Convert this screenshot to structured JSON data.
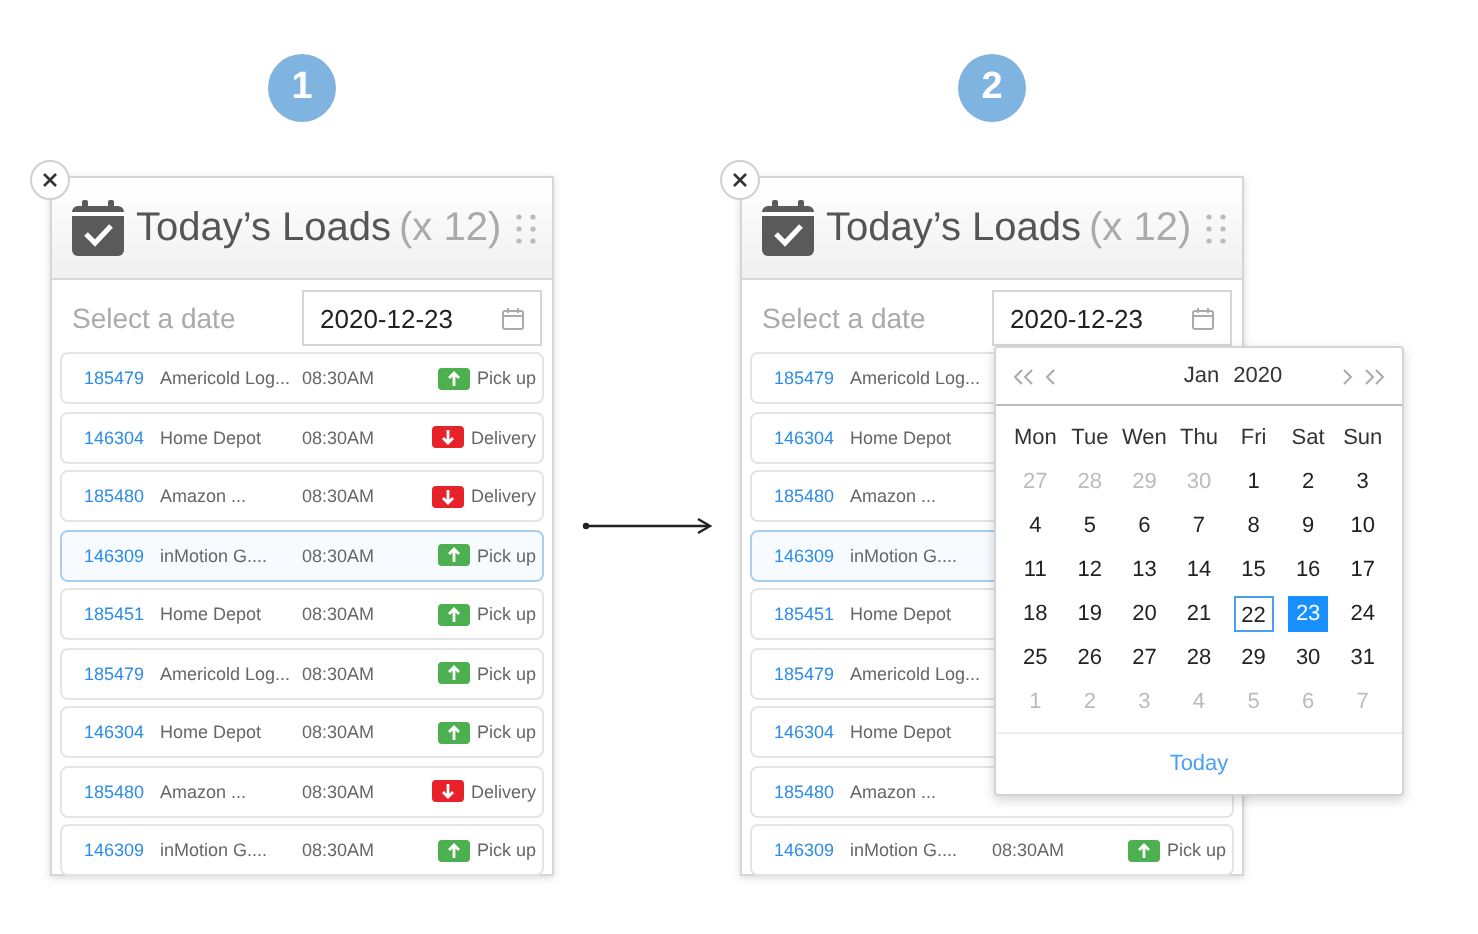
{
  "steps": [
    {
      "number": "1",
      "panel": {
        "title": "Today’s Loads",
        "count": "(x 12)",
        "date_label": "Select a date",
        "date_value": "2020-12-23",
        "rows": [
          {
            "id": "185479",
            "customer": "Americold Log...",
            "time": "08:30AM",
            "kind": "pickup",
            "type": "Pick up",
            "selected": false
          },
          {
            "id": "146304",
            "customer": "Home Depot",
            "time": "08:30AM",
            "kind": "delivery",
            "type": "Delivery",
            "selected": false
          },
          {
            "id": "185480",
            "customer": "Amazon ...",
            "time": "08:30AM",
            "kind": "delivery",
            "type": "Delivery",
            "selected": false
          },
          {
            "id": "146309",
            "customer": "inMotion G....",
            "time": "08:30AM",
            "kind": "pickup",
            "type": "Pick up",
            "selected": true
          },
          {
            "id": "185451",
            "customer": "Home Depot",
            "time": "08:30AM",
            "kind": "pickup",
            "type": "Pick up",
            "selected": false
          },
          {
            "id": "185479",
            "customer": "Americold Log...",
            "time": "08:30AM",
            "kind": "pickup",
            "type": "Pick up",
            "selected": false
          },
          {
            "id": "146304",
            "customer": "Home Depot",
            "time": "08:30AM",
            "kind": "pickup",
            "type": "Pick up",
            "selected": false
          },
          {
            "id": "185480",
            "customer": "Amazon ...",
            "time": "08:30AM",
            "kind": "delivery",
            "type": "Delivery",
            "selected": false
          },
          {
            "id": "146309",
            "customer": "inMotion G....",
            "time": "08:30AM",
            "kind": "pickup",
            "type": "Pick up",
            "selected": false
          }
        ]
      }
    },
    {
      "number": "2",
      "panel": {
        "title": "Today’s Loads",
        "count": "(x 12)",
        "date_label": "Select a date",
        "date_value": "2020-12-23",
        "rows": [
          {
            "id": "185479",
            "customer": "Americold Log...",
            "selected": false
          },
          {
            "id": "146304",
            "customer": "Home Depot",
            "selected": false
          },
          {
            "id": "185480",
            "customer": "Amazon ...",
            "selected": false
          },
          {
            "id": "146309",
            "customer": "inMotion G....",
            "selected": true
          },
          {
            "id": "185451",
            "customer": "Home Depot",
            "selected": false
          },
          {
            "id": "185479",
            "customer": "Americold Log...",
            "selected": false
          },
          {
            "id": "146304",
            "customer": "Home Depot",
            "selected": false
          },
          {
            "id": "185480",
            "customer": "Amazon ...",
            "selected": false
          },
          {
            "id": "146309",
            "customer": "inMotion G....",
            "time": "08:30AM",
            "kind": "pickup",
            "type": "Pick up",
            "selected": false
          }
        ],
        "calendar": {
          "month": "Jan",
          "year": "2020",
          "weekdays": [
            "Mon",
            "Tue",
            "Wen",
            "Thu",
            "Fri",
            "Sat",
            "Sun"
          ],
          "footer": "Today",
          "days": [
            {
              "label": "27",
              "kind": "other",
              "selected": false,
              "today": false
            },
            {
              "label": "28",
              "kind": "other",
              "selected": false,
              "today": false
            },
            {
              "label": "29",
              "kind": "other",
              "selected": false,
              "today": false
            },
            {
              "label": "30",
              "kind": "other",
              "selected": false,
              "today": false
            },
            {
              "label": "1",
              "kind": "current",
              "selected": false,
              "today": false
            },
            {
              "label": "2",
              "kind": "current",
              "selected": false,
              "today": false
            },
            {
              "label": "3",
              "kind": "current",
              "selected": false,
              "today": false
            },
            {
              "label": "4",
              "kind": "current",
              "selected": false,
              "today": false
            },
            {
              "label": "5",
              "kind": "current",
              "selected": false,
              "today": false
            },
            {
              "label": "6",
              "kind": "current",
              "selected": false,
              "today": false
            },
            {
              "label": "7",
              "kind": "current",
              "selected": false,
              "today": false
            },
            {
              "label": "8",
              "kind": "current",
              "selected": false,
              "today": false
            },
            {
              "label": "9",
              "kind": "current",
              "selected": false,
              "today": false
            },
            {
              "label": "10",
              "kind": "current",
              "selected": false,
              "today": false
            },
            {
              "label": "11",
              "kind": "current",
              "selected": false,
              "today": false
            },
            {
              "label": "12",
              "kind": "current",
              "selected": false,
              "today": false
            },
            {
              "label": "13",
              "kind": "current",
              "selected": false,
              "today": false
            },
            {
              "label": "14",
              "kind": "current",
              "selected": false,
              "today": false
            },
            {
              "label": "15",
              "kind": "current",
              "selected": false,
              "today": false
            },
            {
              "label": "16",
              "kind": "current",
              "selected": false,
              "today": false
            },
            {
              "label": "17",
              "kind": "current",
              "selected": false,
              "today": false
            },
            {
              "label": "18",
              "kind": "current",
              "selected": false,
              "today": false
            },
            {
              "label": "19",
              "kind": "current",
              "selected": false,
              "today": false
            },
            {
              "label": "20",
              "kind": "current",
              "selected": false,
              "today": false
            },
            {
              "label": "21",
              "kind": "current",
              "selected": false,
              "today": false
            },
            {
              "label": "22",
              "kind": "current",
              "selected": false,
              "today": true
            },
            {
              "label": "23",
              "kind": "current",
              "selected": true,
              "today": false
            },
            {
              "label": "24",
              "kind": "current",
              "selected": false,
              "today": false
            },
            {
              "label": "25",
              "kind": "current",
              "selected": false,
              "today": false
            },
            {
              "label": "26",
              "kind": "current",
              "selected": false,
              "today": false
            },
            {
              "label": "27",
              "kind": "current",
              "selected": false,
              "today": false
            },
            {
              "label": "28",
              "kind": "current",
              "selected": false,
              "today": false
            },
            {
              "label": "29",
              "kind": "current",
              "selected": false,
              "today": false
            },
            {
              "label": "30",
              "kind": "current",
              "selected": false,
              "today": false
            },
            {
              "label": "31",
              "kind": "current",
              "selected": false,
              "today": false
            },
            {
              "label": "1",
              "kind": "other",
              "selected": false,
              "today": false
            },
            {
              "label": "2",
              "kind": "other",
              "selected": false,
              "today": false
            },
            {
              "label": "3",
              "kind": "other",
              "selected": false,
              "today": false
            },
            {
              "label": "4",
              "kind": "other",
              "selected": false,
              "today": false
            },
            {
              "label": "5",
              "kind": "other",
              "selected": false,
              "today": false
            },
            {
              "label": "6",
              "kind": "other",
              "selected": false,
              "today": false
            },
            {
              "label": "7",
              "kind": "other",
              "selected": false,
              "today": false
            }
          ]
        }
      }
    }
  ]
}
